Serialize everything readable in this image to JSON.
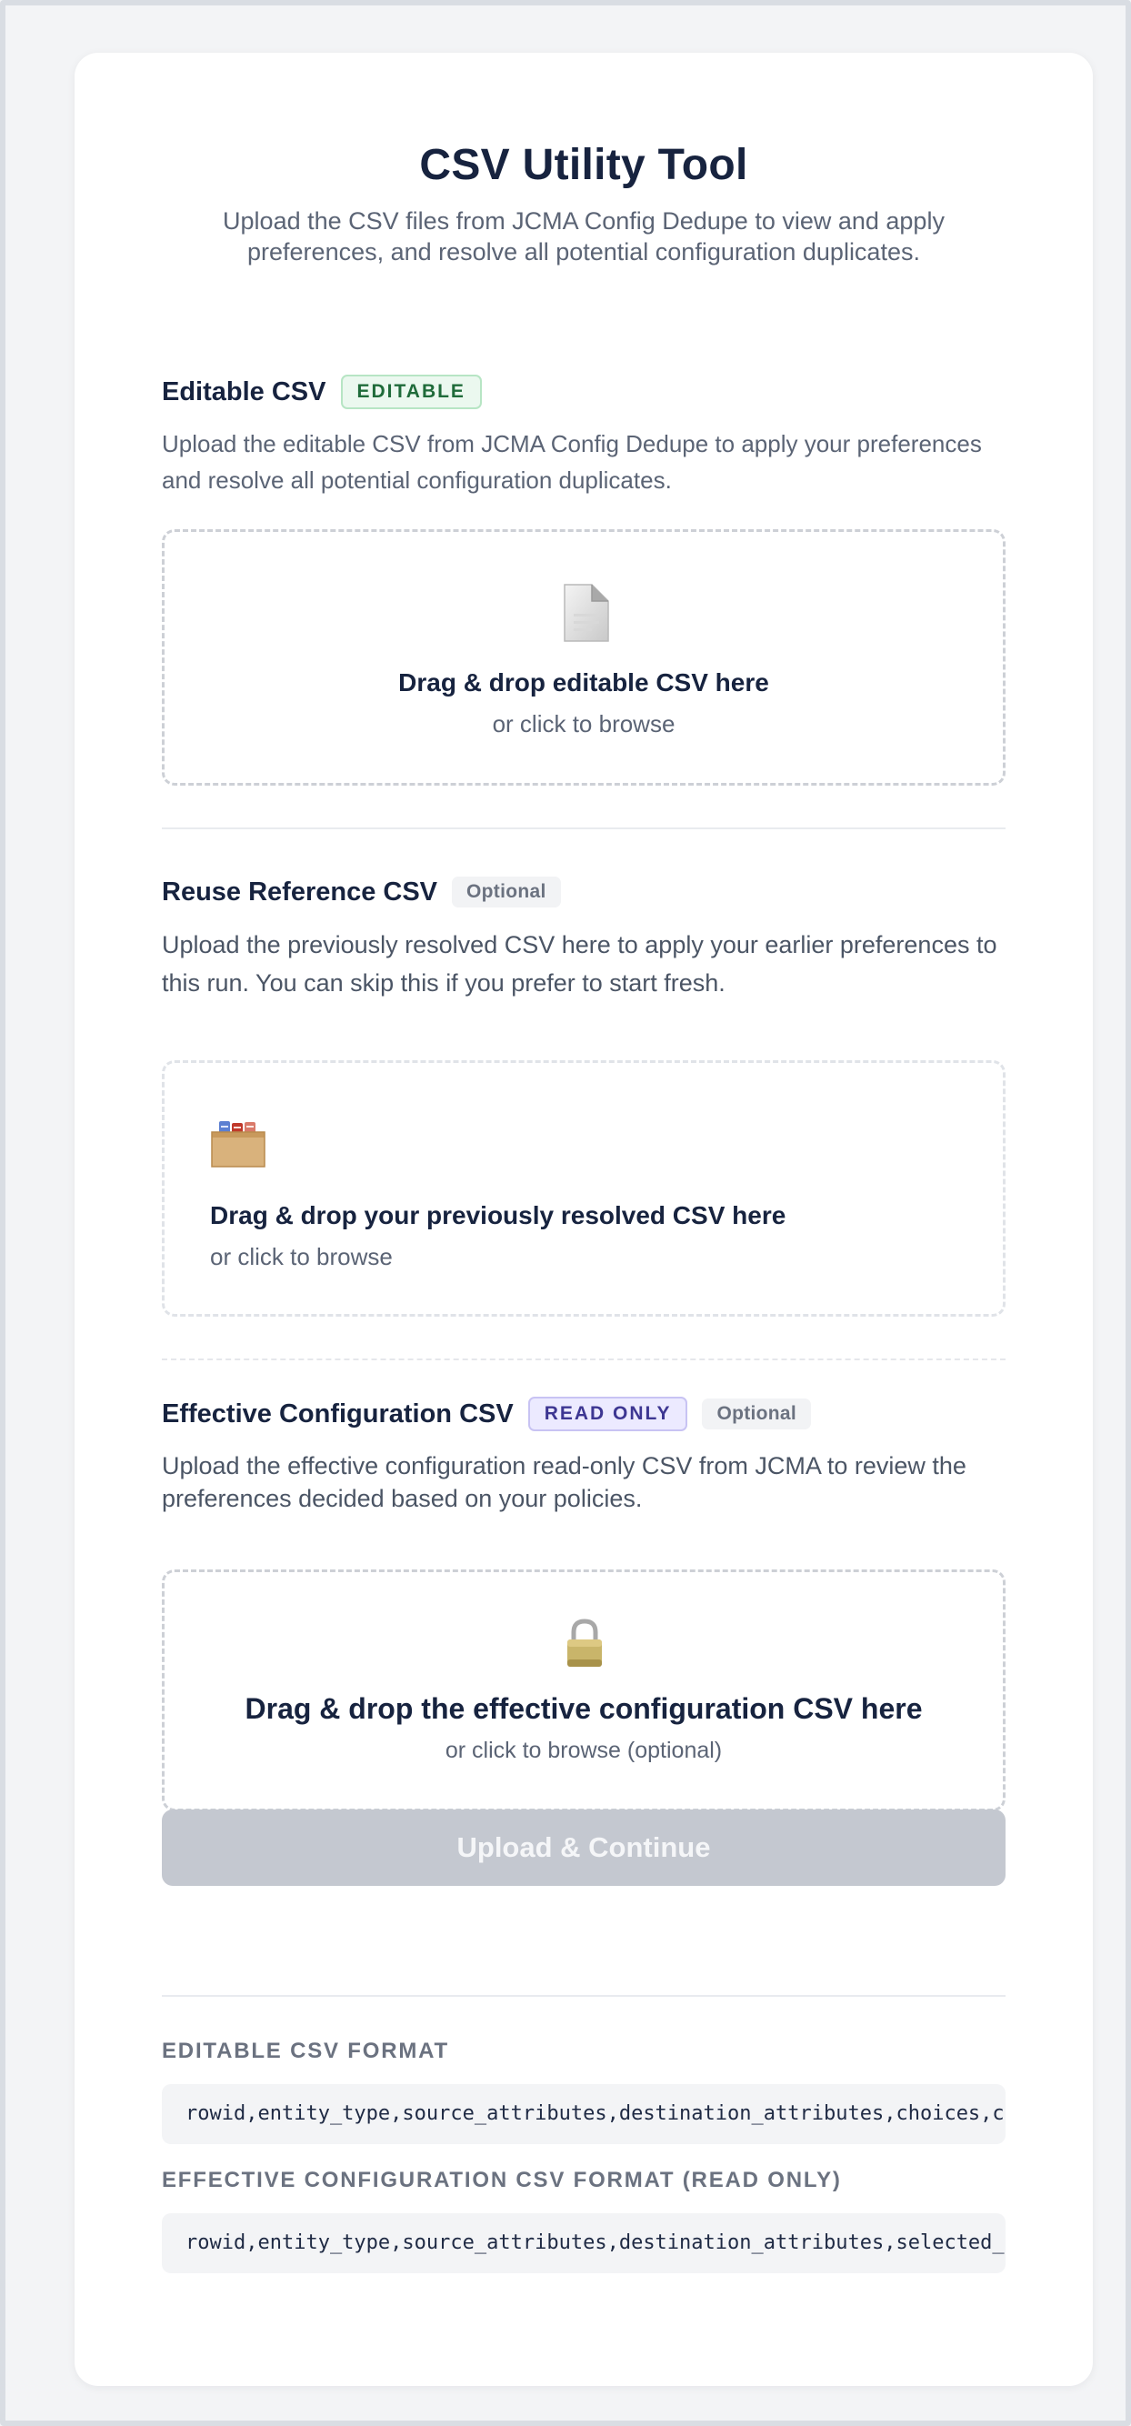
{
  "header": {
    "title": "CSV Utility Tool",
    "subtitle": "Upload the CSV files from JCMA Config Dedupe to view and apply preferences, and resolve all potential configuration duplicates."
  },
  "editable": {
    "title": "Editable CSV",
    "badge": "EDITABLE",
    "description": "Upload the editable CSV from JCMA Config Dedupe to apply your preferences and resolve all potential configuration duplicates.",
    "drop_title": "Drag & drop editable CSV here",
    "drop_sub": "or click to browse",
    "icon": "document-icon"
  },
  "reuse": {
    "title": "Reuse Reference CSV",
    "badge": "Optional",
    "description": "Upload the previously resolved CSV here to apply your earlier preferences to this run. You can skip this if you prefer to start fresh.",
    "drop_title": "Drag & drop your previously resolved CSV here",
    "drop_sub": "or click to browse",
    "icon": "card-file-box-icon"
  },
  "effective": {
    "title": "Effective Configuration CSV",
    "badge_readonly": "READ ONLY",
    "badge_optional": "Optional",
    "description": "Upload the effective configuration read-only CSV from JCMA to review the preferences decided based on your policies.",
    "drop_title": "Drag & drop the effective configuration CSV here",
    "drop_sub": "or click to browse (optional)",
    "icon": "lock-icon"
  },
  "actions": {
    "upload_label": "Upload & Continue"
  },
  "formats": {
    "editable_label": "EDITABLE CSV FORMAT",
    "editable_code": "rowid,entity_type,source_attributes,destination_attributes,choices,comments",
    "effective_label": "EFFECTIVE CONFIGURATION CSV FORMAT (READ ONLY)",
    "effective_code": "rowid,entity_type,source_attributes,destination_attributes,selected_option"
  },
  "colors": {
    "page_bg": "#f3f4f6",
    "card_bg": "#ffffff",
    "title": "#17233f",
    "editable_badge_bg": "#ebf8ef",
    "readonly_badge_bg": "#eceaff",
    "button_disabled": "#c4c8d0"
  }
}
